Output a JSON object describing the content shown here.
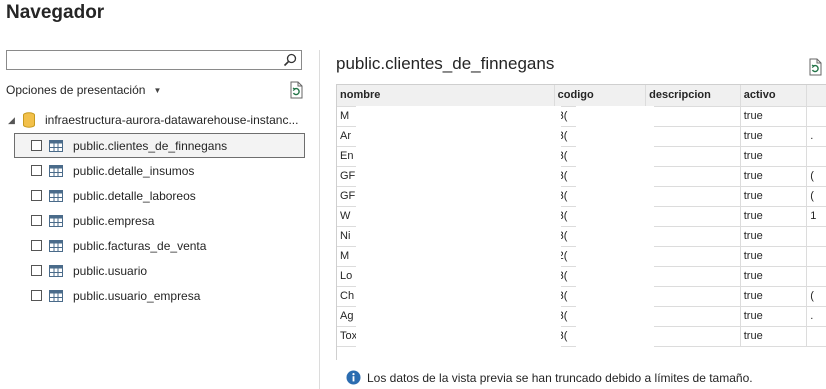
{
  "window": {
    "title": "Navegador"
  },
  "left": {
    "search": {
      "placeholder": ""
    },
    "display_options_label": "Opciones de presentación",
    "tree_root": {
      "label": "infraestructura-aurora-datawarehouse-instanc..."
    },
    "items": [
      {
        "label": "public.clientes_de_finnegans",
        "selected": true
      },
      {
        "label": "public.detalle_insumos"
      },
      {
        "label": "public.detalle_laboreos"
      },
      {
        "label": "public.empresa"
      },
      {
        "label": "public.facturas_de_venta"
      },
      {
        "label": "public.usuario"
      },
      {
        "label": "public.usuario_empresa"
      }
    ]
  },
  "preview": {
    "title": "public.clientes_de_finnegans",
    "columns": [
      "nombre",
      "codigo",
      "descripcion",
      "activo",
      ""
    ],
    "rows": [
      [
        "M",
        "3(",
        "",
        "true",
        ""
      ],
      [
        "Ar",
        "3(",
        "",
        "true",
        "."
      ],
      [
        "En",
        "3(",
        "",
        "true",
        ""
      ],
      [
        "GF",
        "3(",
        "",
        "true",
        "("
      ],
      [
        "GF",
        "3(",
        "",
        "true",
        "("
      ],
      [
        "W",
        "3(",
        "",
        "true",
        "1"
      ],
      [
        "Ni",
        "3(",
        "",
        "true",
        ""
      ],
      [
        "M",
        "2(",
        "",
        "true",
        ""
      ],
      [
        "Lo",
        "3(",
        "",
        "true",
        ""
      ],
      [
        "Ch",
        "3(",
        "",
        "true",
        "("
      ],
      [
        "Ag",
        "3(",
        "",
        "true",
        "."
      ],
      [
        "Toxqui",
        "3(",
        "",
        "true",
        ""
      ]
    ],
    "truncation_notice": "Los datos de la vista previa se han truncado debido a límites de tamaño."
  },
  "colors": {
    "accent": "#217346",
    "info": "#2b6cb0",
    "selected_bg": "#f3f3f3"
  }
}
